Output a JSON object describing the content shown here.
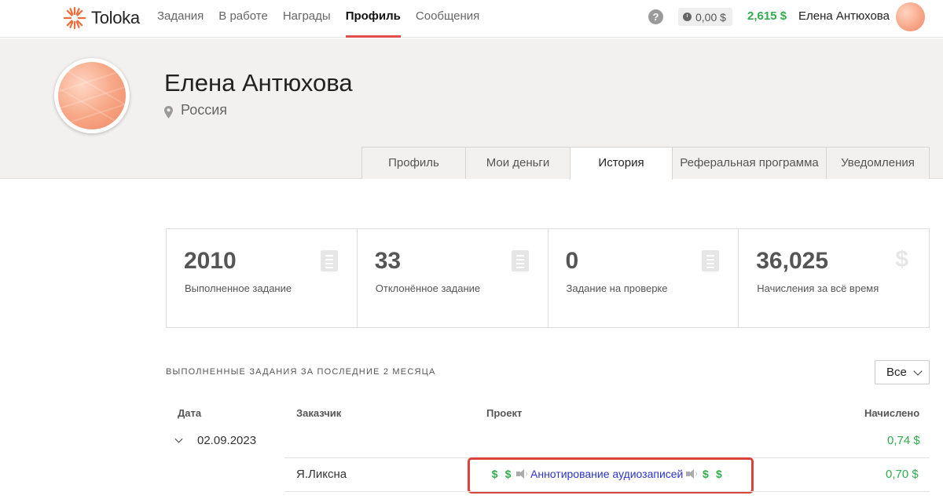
{
  "brand": {
    "name": "Toloka",
    "accent": "#e14c4c"
  },
  "nav": {
    "items": [
      {
        "label": "Задания",
        "active": false
      },
      {
        "label": "В работе",
        "active": false
      },
      {
        "label": "Награды",
        "active": false
      },
      {
        "label": "Профиль",
        "active": true
      },
      {
        "label": "Сообщения",
        "active": false
      }
    ]
  },
  "header": {
    "help_icon": "?",
    "pending_balance": "0,00 $",
    "balance": "2,615 $",
    "user_name": "Елена Антюхова",
    "balance_color": "#2fae4c"
  },
  "profile": {
    "name": "Елена Антюхова",
    "country": "Россия",
    "tabs": [
      {
        "label": "Профиль",
        "active": false
      },
      {
        "label": "Мои деньги",
        "active": false
      },
      {
        "label": "История",
        "active": true
      },
      {
        "label": "Реферальная программа",
        "active": false
      },
      {
        "label": "Уведомления",
        "active": false
      }
    ]
  },
  "stats": [
    {
      "value": "2010",
      "label": "Выполненное задание",
      "icon": "document-icon"
    },
    {
      "value": "33",
      "label": "Отклонённое задание",
      "icon": "document-icon"
    },
    {
      "value": "0",
      "label": "Задание на проверке",
      "icon": "document-icon"
    },
    {
      "value": "36,025",
      "label": "Начисления за всё время",
      "icon": "dollar-icon"
    }
  ],
  "history": {
    "title": "ВЫПОЛНЕННЫЕ ЗАДАНИЯ ЗА ПОСЛЕДНИЕ 2 МЕСЯЦА",
    "filter": "Все",
    "columns": {
      "date": "Дата",
      "customer": "Заказчик",
      "project": "Проект",
      "earned": "Начислено"
    },
    "groups": [
      {
        "date": "02.09.2023",
        "total": "0,74 $",
        "rows": [
          {
            "customer": "Я.Ликсна",
            "project_prefix": [
              "$",
              "$"
            ],
            "project": "Аннотирование аудиозаписей",
            "project_suffix": [
              "$",
              "$"
            ],
            "earned": "0,70 $"
          }
        ]
      }
    ]
  }
}
